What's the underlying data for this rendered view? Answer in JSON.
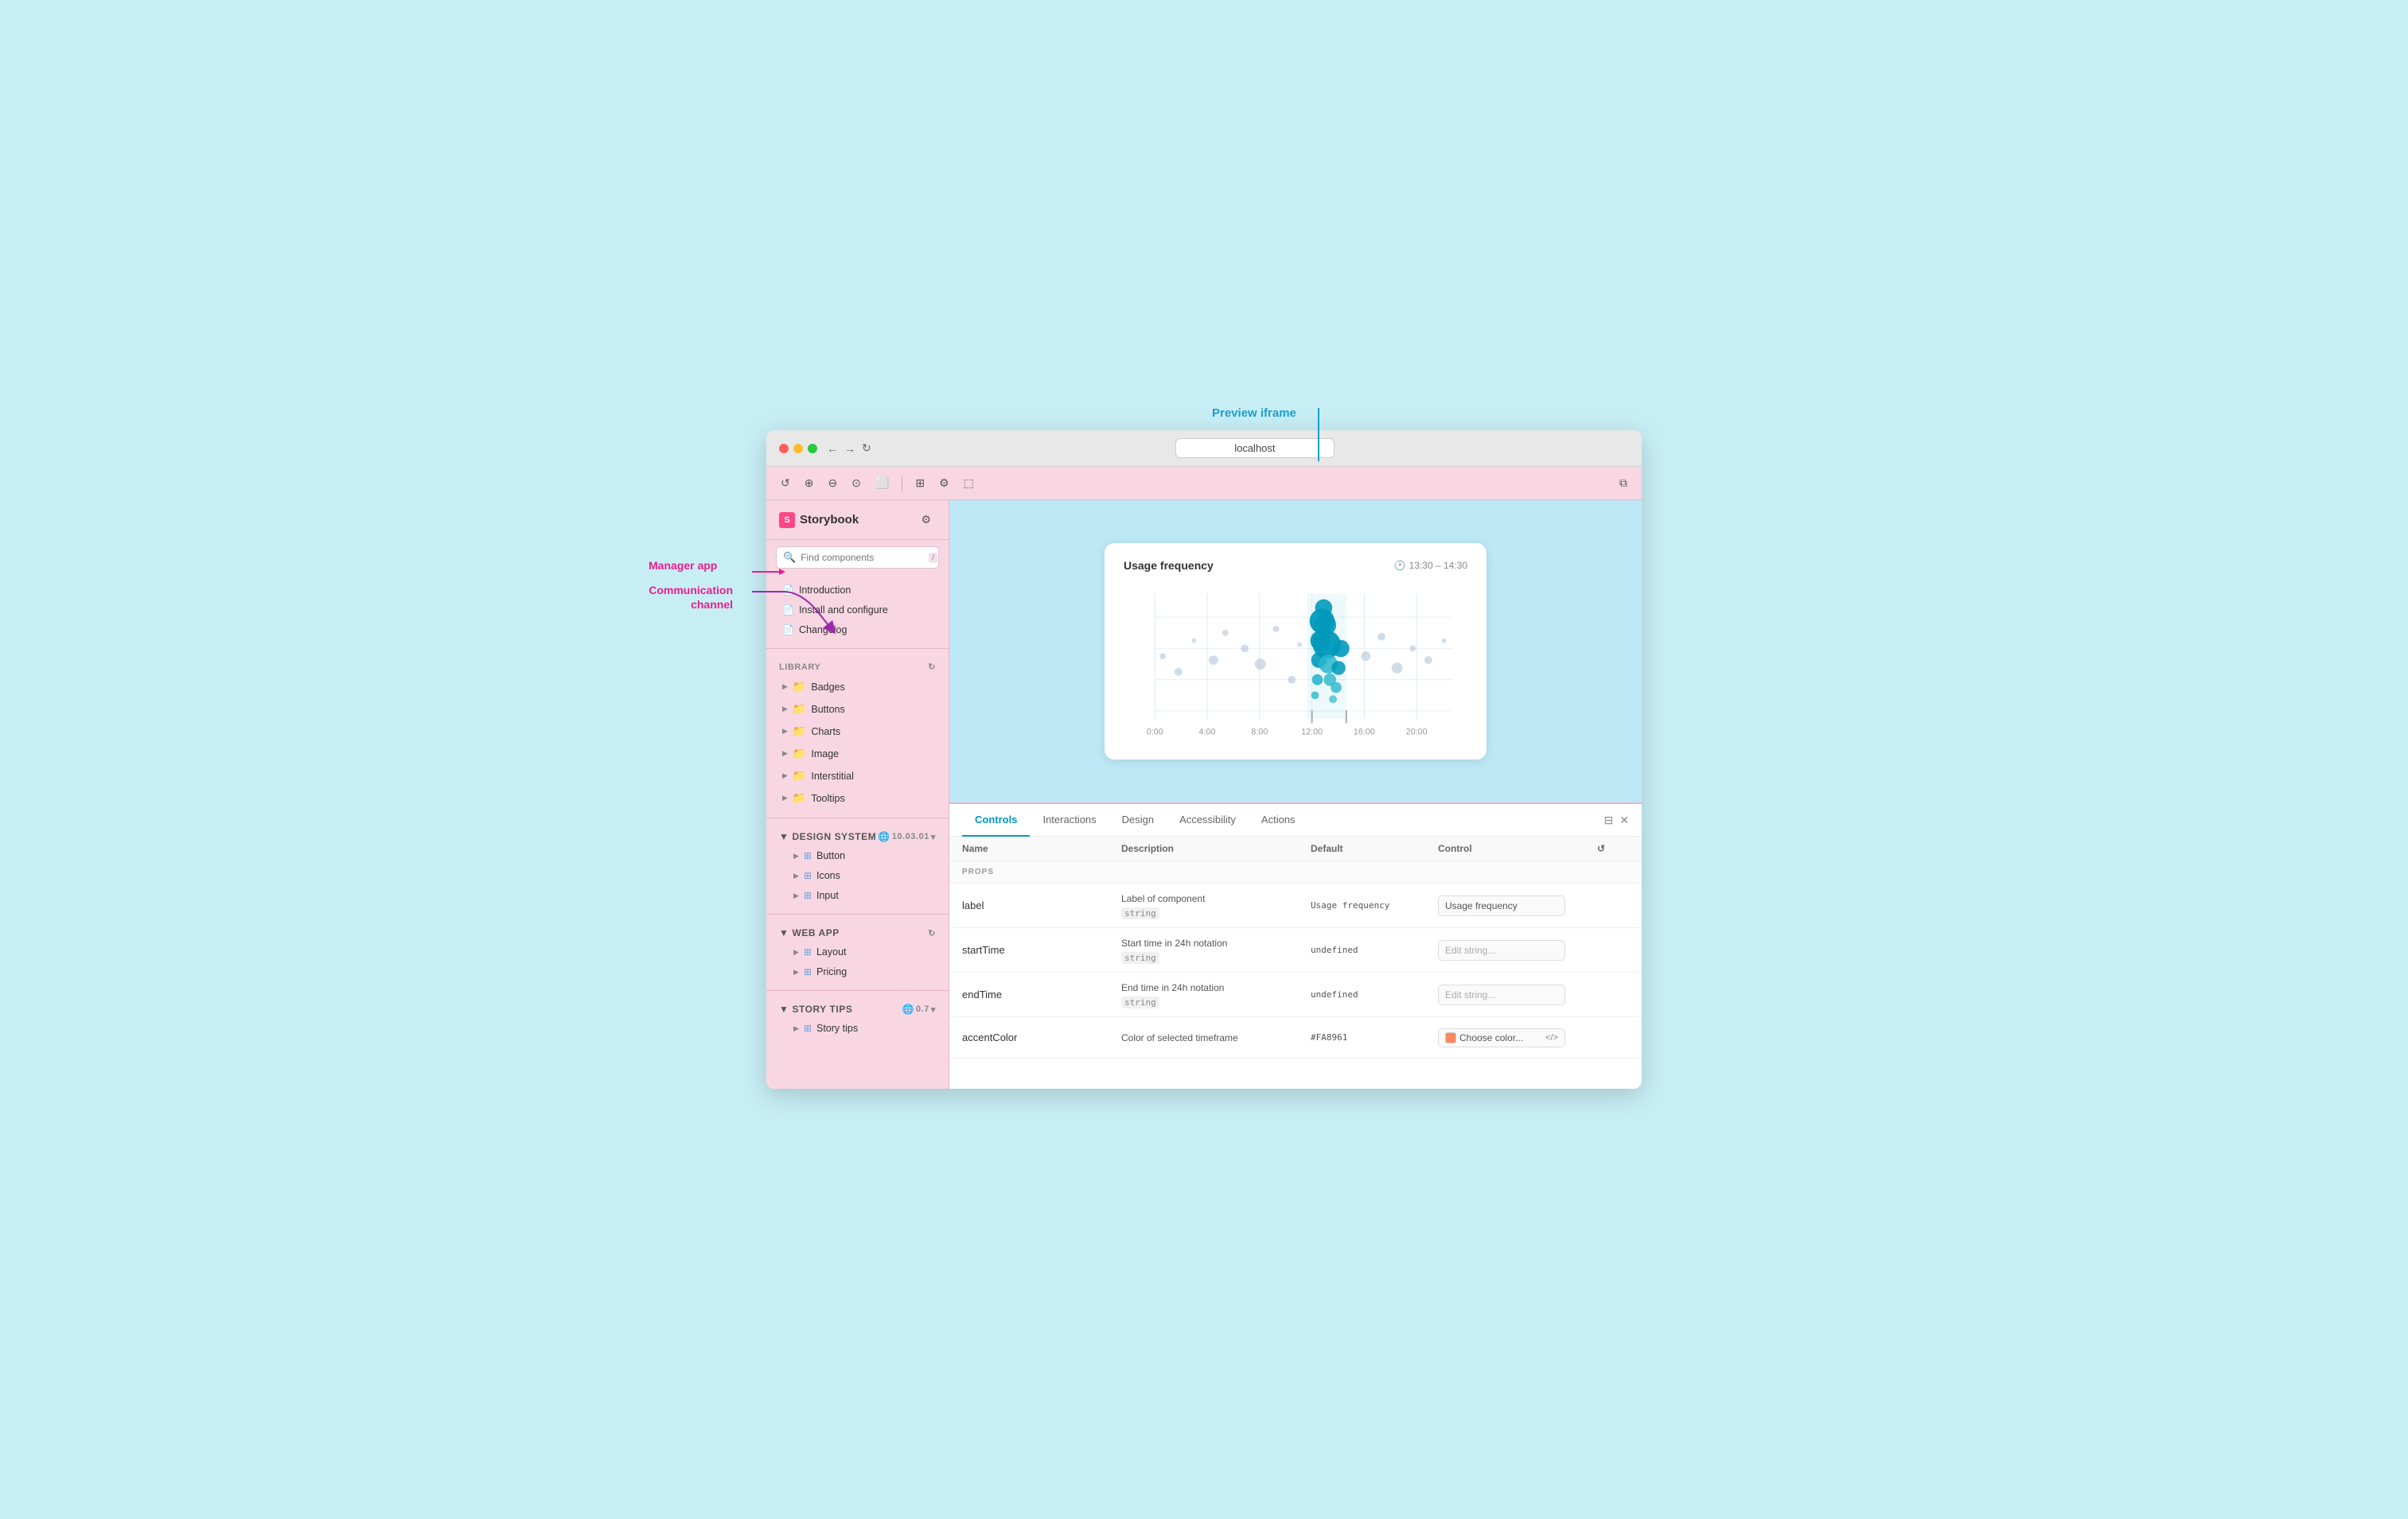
{
  "annotations": {
    "preview_iframe": "Preview iframe",
    "manager_app": "Manager app",
    "communication_channel": "Communication channel"
  },
  "browser": {
    "url": "localhost"
  },
  "toolbar": {
    "buttons": [
      "↺",
      "⊕",
      "⊖",
      "⊙",
      "⬛",
      "☰",
      "⚙",
      "⬚"
    ],
    "external_icon": "⧉"
  },
  "sidebar": {
    "logo": "Storybook",
    "search_placeholder": "Find components",
    "search_shortcut": "/",
    "docs": [
      {
        "label": "Introduction",
        "icon": "doc"
      },
      {
        "label": "Install and configure",
        "icon": "doc"
      },
      {
        "label": "Changelog",
        "icon": "doc"
      }
    ],
    "library_section": "LIBRARY",
    "library_items": [
      {
        "label": "Badges",
        "icon": "folder"
      },
      {
        "label": "Buttons",
        "icon": "folder"
      },
      {
        "label": "Charts",
        "icon": "folder"
      },
      {
        "label": "Image",
        "icon": "folder"
      },
      {
        "label": "Interstitial",
        "icon": "folder"
      },
      {
        "label": "Tooltips",
        "icon": "folder"
      }
    ],
    "design_system_section": "Design system",
    "design_system_version": "10.03.01",
    "design_system_items": [
      {
        "label": "Button",
        "icon": "component"
      },
      {
        "label": "Icons",
        "icon": "component"
      },
      {
        "label": "Input",
        "icon": "component"
      }
    ],
    "web_app_section": "WEB APP",
    "web_app_items": [
      {
        "label": "Layout",
        "icon": "component"
      },
      {
        "label": "Pricing",
        "icon": "component"
      }
    ],
    "story_tips_section": "Story tips",
    "story_tips_version": "0.7",
    "story_tips_items": [
      {
        "label": "Story tips",
        "icon": "component"
      }
    ]
  },
  "chart": {
    "title": "Usage frequency",
    "time_range": "13:30 – 14:30",
    "x_labels": [
      "0:00",
      "4:00",
      "8:00",
      "12:00",
      "16:00",
      "20:00"
    ]
  },
  "controls": {
    "tabs": [
      "Controls",
      "Interactions",
      "Design",
      "Accessibility",
      "Actions"
    ],
    "active_tab": "Controls",
    "table_headers": {
      "name": "Name",
      "description": "Description",
      "default": "Default",
      "control": "Control"
    },
    "section_label": "PROPS",
    "props": [
      {
        "name": "label",
        "description": "Label of component",
        "type": "string",
        "default": "Usage frequency",
        "control_type": "text",
        "control_value": "Usage frequency",
        "control_placeholder": ""
      },
      {
        "name": "startTime",
        "description": "Start time in 24h notation",
        "type": "string",
        "default": "undefined",
        "control_type": "text",
        "control_value": "",
        "control_placeholder": "Edit string..."
      },
      {
        "name": "endTime",
        "description": "End time in 24h notation",
        "type": "string",
        "default": "undefined",
        "control_type": "text",
        "control_value": "",
        "control_placeholder": "Edit string..."
      },
      {
        "name": "accentColor",
        "description": "Color of selected timeframe",
        "type": "",
        "default": "#FA8961",
        "control_type": "color",
        "color_value": "#FA8961"
      }
    ]
  }
}
